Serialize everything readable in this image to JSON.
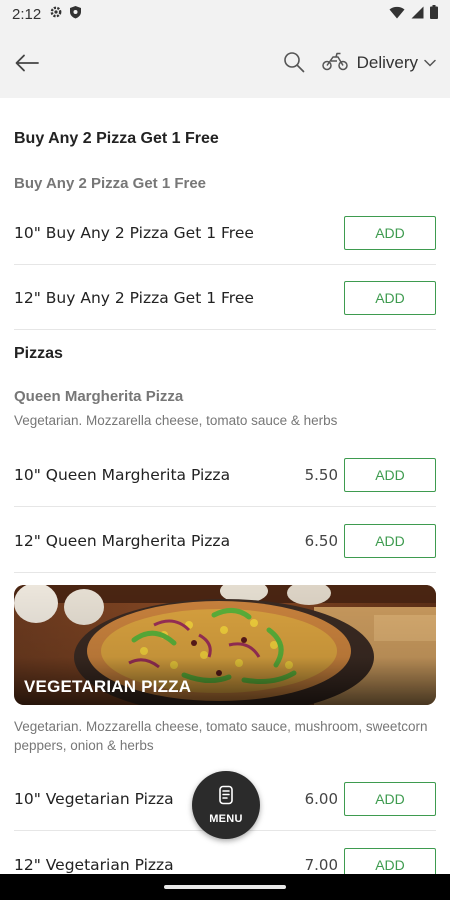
{
  "status_bar": {
    "time": "2:12"
  },
  "header": {
    "delivery_label": "Delivery"
  },
  "sections": [
    {
      "title": "Buy Any 2 Pizza Get 1 Free",
      "group_title": "Buy Any 2 Pizza Get 1 Free",
      "items": [
        {
          "name": "10\" Buy Any 2 Pizza Get 1 Free",
          "price": "",
          "add": "ADD"
        },
        {
          "name": "12\" Buy Any 2 Pizza Get 1 Free",
          "price": "",
          "add": "ADD"
        }
      ]
    },
    {
      "title": "Pizzas",
      "groups": [
        {
          "title": "Queen Margherita Pizza",
          "description": "Vegetarian. Mozzarella cheese, tomato sauce & herbs",
          "items": [
            {
              "name": "10\" Queen Margherita Pizza",
              "price": "5.50",
              "add": "ADD"
            },
            {
              "name": "12\" Queen Margherita Pizza",
              "price": "6.50",
              "add": "ADD"
            }
          ]
        },
        {
          "banner_label": "VEGETARIAN PIZZA",
          "description": "Vegetarian. Mozzarella cheese, tomato sauce, mushroom, sweetcorn peppers, onion & herbs",
          "items": [
            {
              "name": "10\" Vegetarian Pizza",
              "price": "6.00",
              "add": "ADD"
            },
            {
              "name": "12\" Vegetarian Pizza",
              "price": "7.00",
              "add": "ADD"
            }
          ]
        }
      ]
    }
  ],
  "menu_fab": {
    "label": "MENU"
  },
  "colors": {
    "accent": "#3e9b4f",
    "fab": "#2b2b2b",
    "header_bg": "#f2f2f2"
  },
  "icons": [
    "gear-icon",
    "shield-icon",
    "wifi-icon",
    "signal-icon",
    "battery-icon",
    "back-arrow-icon",
    "search-icon",
    "scooter-icon",
    "chevron-down-icon",
    "menu-book-icon"
  ]
}
